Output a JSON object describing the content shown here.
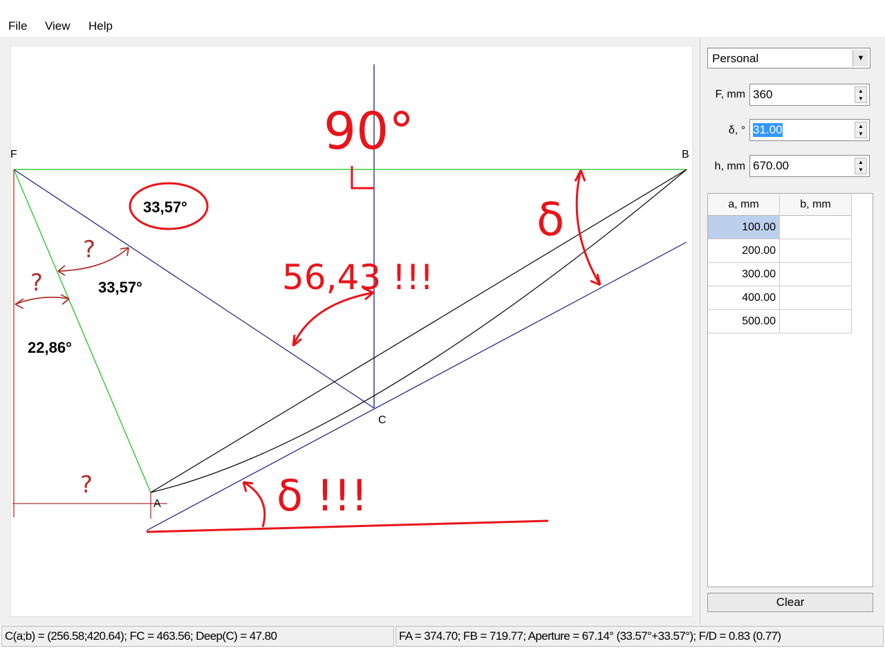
{
  "menu": {
    "items": [
      "File",
      "View",
      "Help"
    ]
  },
  "panel": {
    "profile": "Personal",
    "fields": [
      {
        "label": "F, mm",
        "value": "360"
      },
      {
        "label": "δ, °",
        "value": "31.00"
      },
      {
        "label": "h, mm",
        "value": "670.00"
      }
    ],
    "table": {
      "headers": [
        "a, mm",
        "b, mm"
      ],
      "rows": [
        [
          "100.00",
          ""
        ],
        [
          "200.00",
          ""
        ],
        [
          "300.00",
          ""
        ],
        [
          "400.00",
          ""
        ],
        [
          "500.00",
          ""
        ]
      ]
    },
    "clear_label": "Clear"
  },
  "drawing": {
    "points": {
      "F": "F",
      "B": "B",
      "C": "C",
      "A": "A"
    },
    "angles": {
      "a1": "33,57°",
      "a2": "33,57°",
      "a3": "22,86°"
    },
    "annotations": {
      "right_angle": "90°",
      "angle_big": "56,43 !!!",
      "delta_right": "δ",
      "delta_bottom": "δ !!!",
      "q1": "?",
      "q2": "?",
      "q3": "?"
    },
    "colors": {
      "green": "#3cc83c",
      "navy": "#1a1a80",
      "red": "#e8141a",
      "darkred": "#b03030"
    }
  },
  "status": {
    "left": "C(a;b) = (256.58;420.64); FC = 463.56; Deep(C) = 47.80",
    "right": "FA = 374.70; FB = 719.77; Aperture = 67.14° (33.57°+33.57°); F/D = 0.83 (0.77)"
  }
}
